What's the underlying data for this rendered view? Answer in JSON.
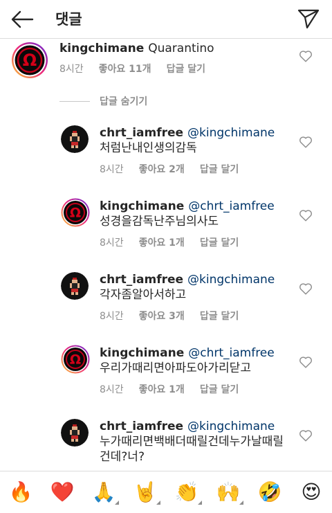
{
  "header": {
    "title": "댓글"
  },
  "parent_comment": {
    "username": "kingchimane",
    "text": "Quarantino",
    "time": "8시간",
    "likes": "좋아요 11개",
    "reply": "답글 달기"
  },
  "hide_replies_label": "답글 숨기기",
  "replies": [
    {
      "username": "chrt_iamfree",
      "mention": "@kingchimane",
      "text": "처럼난내인생의감독",
      "time": "8시간",
      "likes": "좋아요 2개",
      "reply": "답글 달기"
    },
    {
      "username": "kingchimane",
      "mention": "@chrt_iamfree",
      "text": "성경을감독난주님의사도",
      "time": "8시간",
      "likes": "좋아요 1개",
      "reply": "답글 달기"
    },
    {
      "username": "chrt_iamfree",
      "mention": "@kingchimane",
      "text": "각자좀알아서하고",
      "time": "8시간",
      "likes": "좋아요 3개",
      "reply": "답글 달기"
    },
    {
      "username": "kingchimane",
      "mention": "@chrt_iamfree",
      "text": "우리가때리면아파도아가리닫고",
      "time": "8시간",
      "likes": "좋아요 1개",
      "reply": "답글 달기"
    },
    {
      "username": "chrt_iamfree",
      "mention": "@kingchimane",
      "text": "누가때리면백배더때릴건데누가날때릴건데?너?"
    }
  ],
  "emoji_bar": [
    {
      "name": "fire",
      "glyph": "🔥"
    },
    {
      "name": "red-heart",
      "glyph": "❤️"
    },
    {
      "name": "folded-hands",
      "glyph": "🙏"
    },
    {
      "name": "sign-of-horns",
      "glyph": "🤘"
    },
    {
      "name": "clapping-hands",
      "glyph": "👏"
    },
    {
      "name": "raising-hands",
      "glyph": "🙌"
    },
    {
      "name": "rofl-face",
      "glyph": "🤣"
    },
    {
      "name": "heart-eyes-face",
      "glyph": "😍"
    }
  ],
  "colors": {
    "mention": "#003569",
    "meta": "#8e8e8e",
    "text": "#262626",
    "divider": "#dbdbdb",
    "omega_ring": "#c1001a"
  }
}
